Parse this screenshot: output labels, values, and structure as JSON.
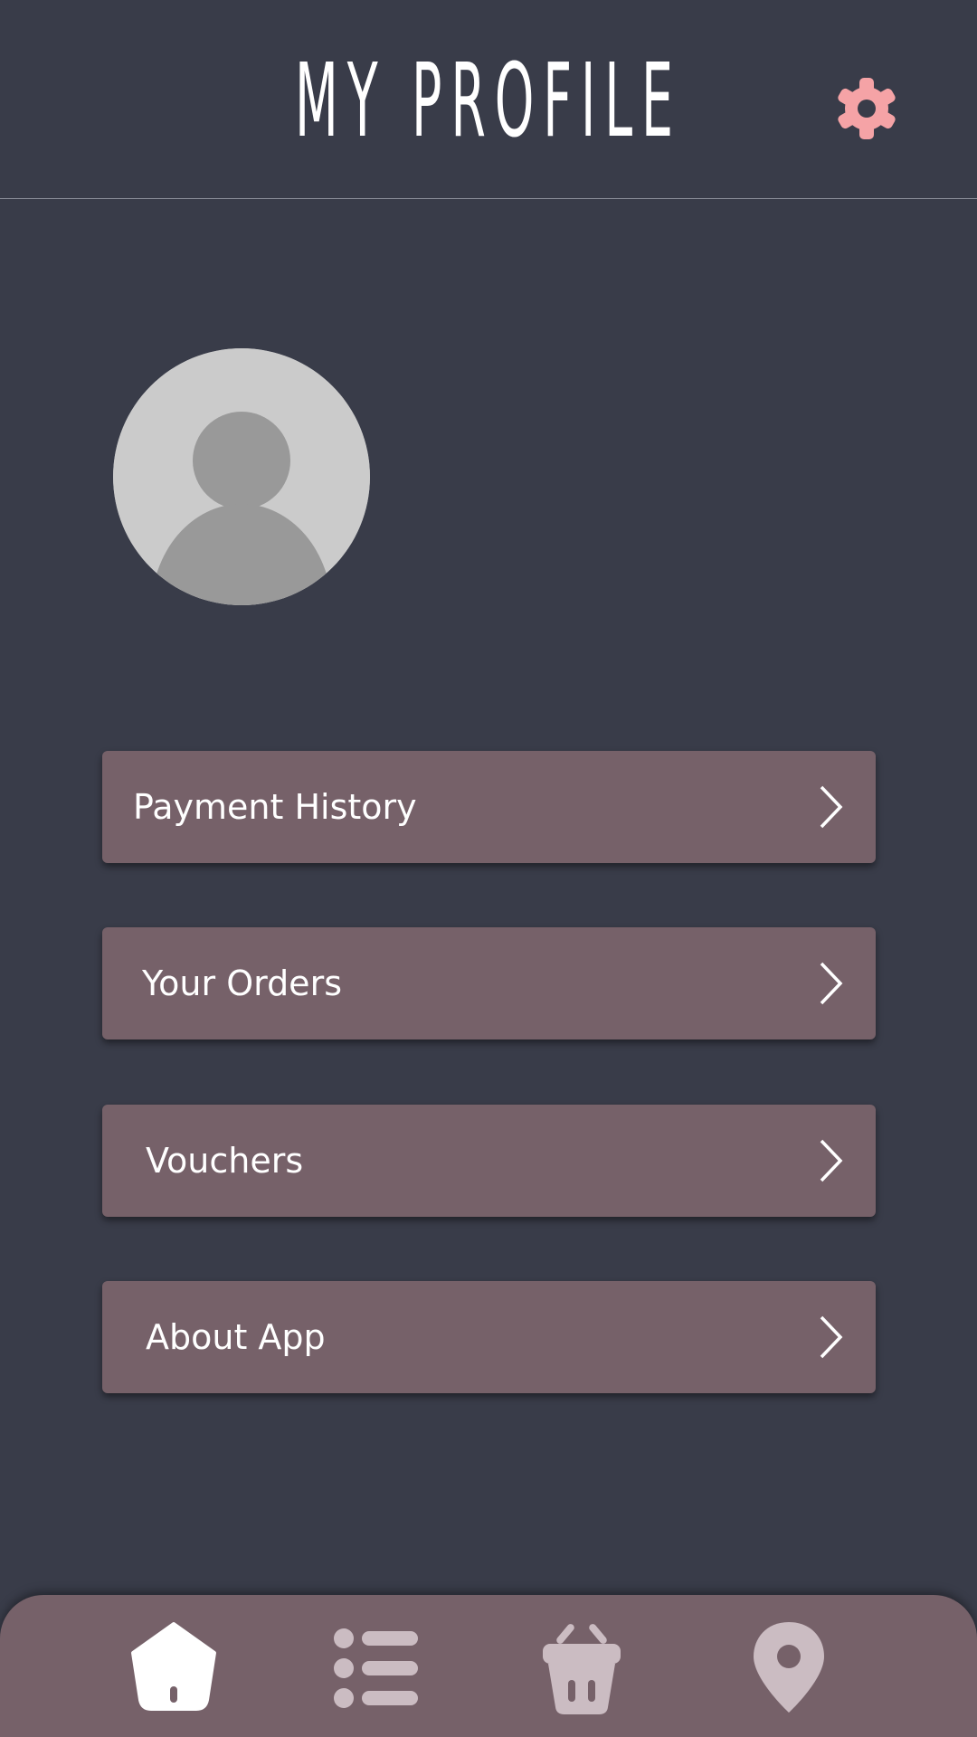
{
  "header": {
    "title": "MY PROFILE"
  },
  "menu": {
    "items": [
      {
        "label": "Payment History"
      },
      {
        "label": "Your Orders"
      },
      {
        "label": "Vouchers"
      },
      {
        "label": "About App"
      }
    ]
  },
  "tabbar": {
    "tabs": [
      {
        "icon": "home-icon",
        "active": true
      },
      {
        "icon": "list-icon",
        "active": false
      },
      {
        "icon": "basket-icon",
        "active": false
      },
      {
        "icon": "location-pin-icon",
        "active": false
      }
    ]
  },
  "colors": {
    "background": "#393c49",
    "card": "#766169",
    "accent": "#f5a3a6",
    "text": "#ffffff",
    "inactive_icon": "#cbbcc2"
  }
}
